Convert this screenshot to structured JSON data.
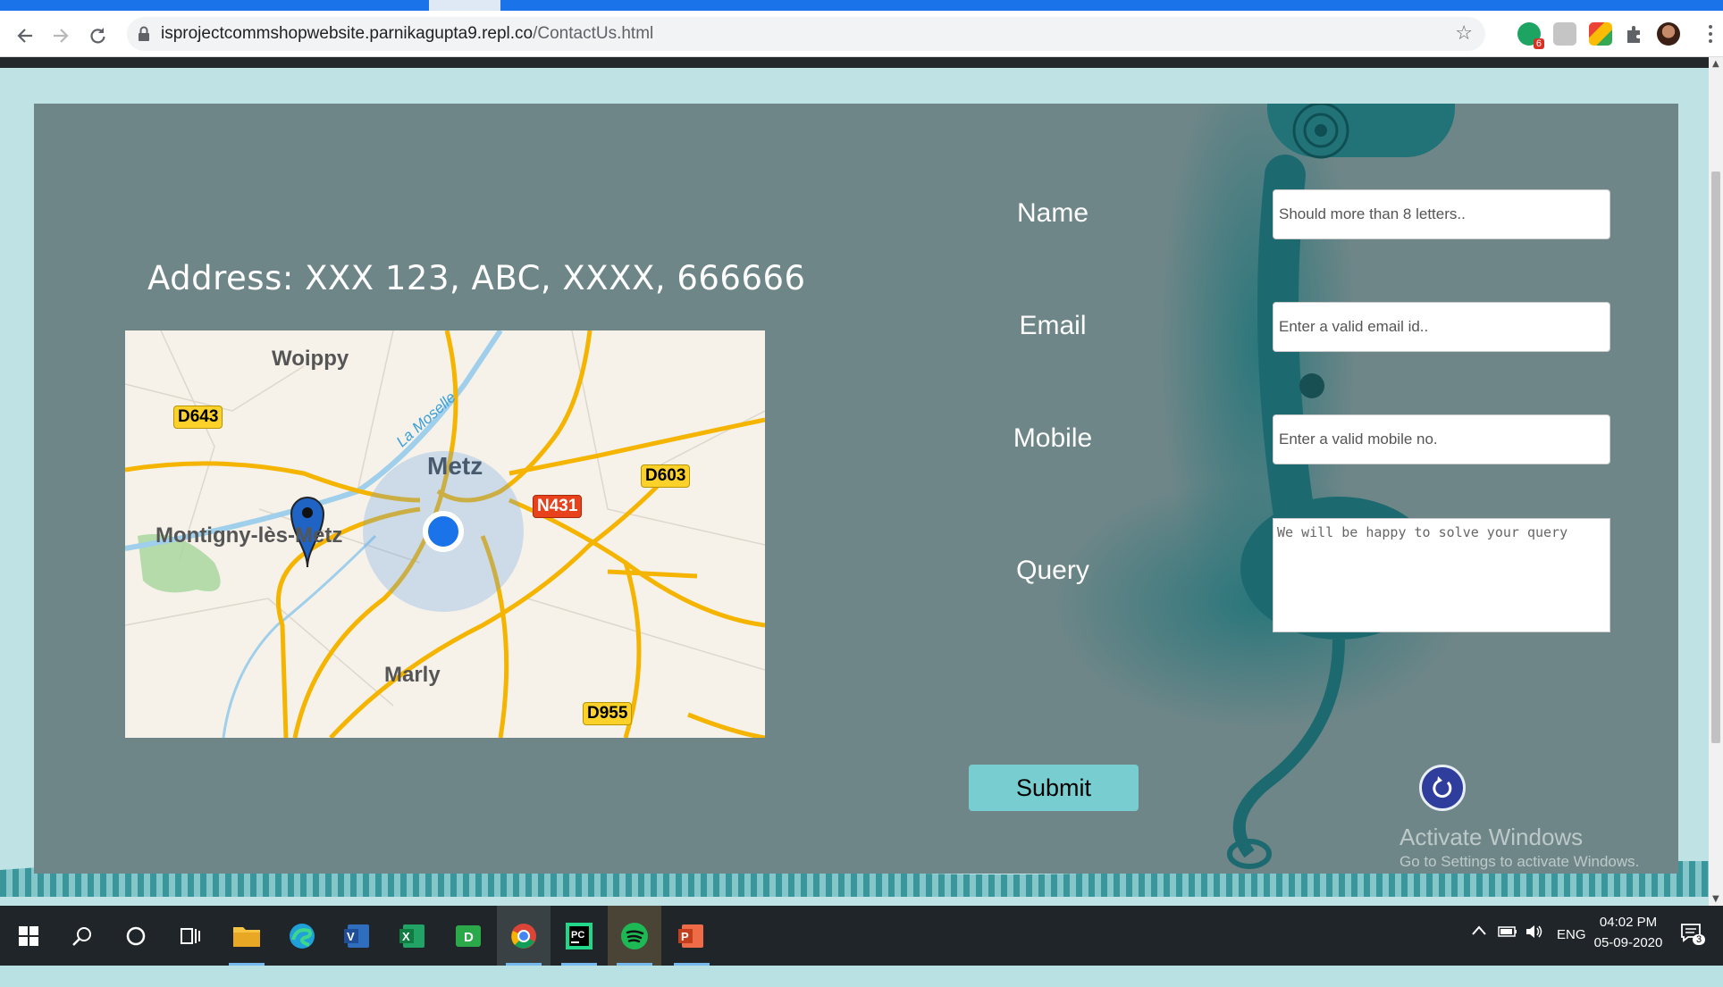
{
  "browser": {
    "url_host": "isprojectcommshopwebsite.parnikagupta9.repl.co",
    "url_path": "/ContactUs.html",
    "extension_badge": "6"
  },
  "contact": {
    "address": "Address: XXX 123, ABC, XXXX, 666666",
    "map": {
      "places": [
        "Woippy",
        "Metz",
        "Montigny-lès-Metz",
        "Marly"
      ],
      "river": "La Moselle",
      "roads": [
        "D643",
        "D603",
        "N431",
        "D955"
      ]
    },
    "form": {
      "name_label": "Name",
      "name_placeholder": "Should more than 8 letters..",
      "email_label": "Email",
      "email_placeholder": "Enter a valid email id..",
      "mobile_label": "Mobile",
      "mobile_placeholder": "Enter a valid mobile no.",
      "query_label": "Query",
      "query_placeholder": "We will be happy to solve your query",
      "submit_label": "Submit"
    }
  },
  "watermark": {
    "line1": "Activate Windows",
    "line2": "Go to Settings to activate Windows."
  },
  "taskbar": {
    "language": "ENG",
    "time": "04:02 PM",
    "date": "05-09-2020",
    "notification_count": "3",
    "apps": [
      "start",
      "search",
      "cortana",
      "task-view",
      "file-explorer",
      "edge",
      "visio",
      "excel",
      "d-app",
      "chrome",
      "pycharm",
      "spotify",
      "powerpoint"
    ]
  },
  "colors": {
    "panel": "#6e8688",
    "page_bg": "#bfe2e4",
    "submit": "#77cdd0",
    "phone": "#1f7479"
  }
}
